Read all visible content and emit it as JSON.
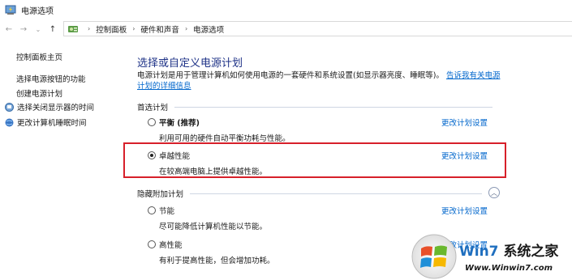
{
  "window": {
    "title": "电源选项"
  },
  "nav": {
    "back": "←",
    "forward": "→",
    "dropdown": "⌄",
    "up": "↑"
  },
  "breadcrumb": [
    "控制面板",
    "硬件和声音",
    "电源选项"
  ],
  "sidebar": {
    "items": [
      {
        "label": "控制面板主页",
        "icon": ""
      },
      {
        "label": "选择电源按钮的功能",
        "icon": ""
      },
      {
        "label": "创建电源计划",
        "icon": ""
      },
      {
        "label": "选择关闭显示器的时间",
        "icon": "monitor-icon"
      },
      {
        "label": "更改计算机睡眠时间",
        "icon": "globe-icon"
      }
    ]
  },
  "main": {
    "title": "选择或自定义电源计划",
    "desc": "电源计划是用于管理计算机如何使用电源的一套硬件和系统设置(如显示器亮度、睡眠等)。",
    "desc_link": "告诉我有关电源计划的详细信息",
    "preferred_label": "首选计划",
    "hidden_label": "隐藏附加计划",
    "change_label": "更改计划设置",
    "plans": [
      {
        "name": "平衡 (推荐)",
        "desc": "利用可用的硬件自动平衡功耗与性能。",
        "selected": false
      },
      {
        "name": "卓越性能",
        "desc": "在较高端电脑上提供卓越性能。",
        "selected": true
      },
      {
        "name": "节能",
        "desc": "尽可能降低计算机性能以节能。",
        "selected": false
      },
      {
        "name": "高性能",
        "desc": "有利于提高性能，但会增加功耗。",
        "selected": false
      }
    ]
  },
  "watermark": {
    "name": "系统之家",
    "url": "Www.Winwin7.com",
    "brand": "Win7"
  },
  "colors": {
    "accent": "#1e3287",
    "link": "#0066cc",
    "highlight": "#d7202a"
  }
}
